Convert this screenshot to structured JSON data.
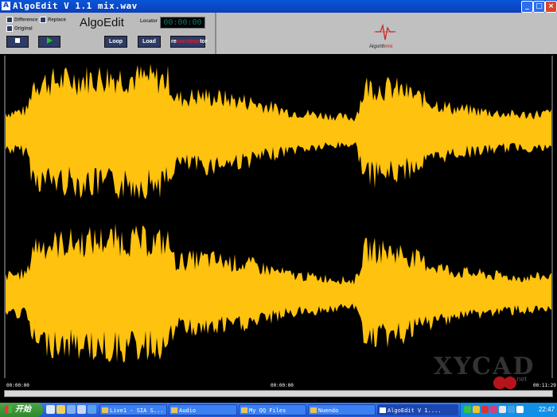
{
  "window": {
    "app_icon_letter": "A",
    "title": "AlgoEdit V 1.1   mix.wav",
    "minimize_glyph": "_",
    "maximize_glyph": "□",
    "close_glyph": "×"
  },
  "panel": {
    "checkboxes": [
      {
        "label": "Difference",
        "checked": false
      },
      {
        "label": "Replace",
        "checked": false
      },
      {
        "label": "Original",
        "checked": false
      }
    ],
    "app_name": "AlgoEdit",
    "locator_label": "Locator",
    "locator_value": "00:00:00",
    "stop_icon": "stop-icon",
    "play_icon": "play-icon",
    "loop_label": "Loop",
    "load_label": "Load",
    "reconstruct_prefix": "re",
    "reconstruct_highlight": "construc",
    "reconstruct_suffix": "tor",
    "logo_text_prefix": "Algorith",
    "logo_text_highlight": "mix"
  },
  "waveform": {
    "color": "#ffc20e",
    "channels": 2
  },
  "timeline": {
    "start": "00:00:00",
    "middle": "00:00:00",
    "end": "00:11:29"
  },
  "watermark": {
    "text": "XYCAD",
    "suffix": ".net"
  },
  "taskbar": {
    "start_label": "开始",
    "tasks": [
      {
        "label": "Live1 - SIA S...",
        "active": false
      },
      {
        "label": "Audio",
        "active": false
      },
      {
        "label": "My QQ Files",
        "active": false
      },
      {
        "label": "Nuendo",
        "active": false
      },
      {
        "label": "AlgoEdit V 1....",
        "active": true
      }
    ],
    "clock": "22:47"
  },
  "colors": {
    "accent": "#ffc20e",
    "panel": "#c0c0c0",
    "button": "#2e3b66",
    "title_bar": "#0a55d8",
    "logo_red": "#d01c1c"
  }
}
